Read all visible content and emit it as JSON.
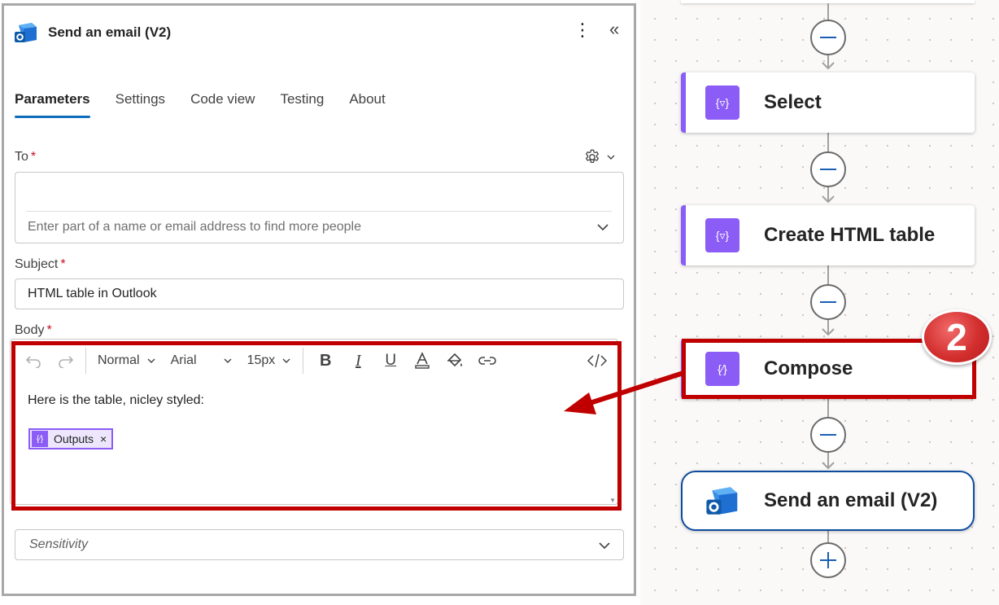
{
  "panel": {
    "title": "Send an email (V2)",
    "tabs": [
      "Parameters",
      "Settings",
      "Code view",
      "Testing",
      "About"
    ],
    "active_tab": "Parameters"
  },
  "fields": {
    "to": {
      "label": "To",
      "required_mark": "*",
      "value": "",
      "placeholder": "Enter part of a name or email address to find more people"
    },
    "subject": {
      "label": "Subject",
      "required_mark": "*",
      "value": "HTML table in Outlook"
    },
    "body": {
      "label": "Body",
      "required_mark": "*",
      "toolbar": {
        "style": "Normal",
        "font": "Arial",
        "size": "15px"
      },
      "text": "Here is the table, nicley styled:",
      "token_label": "Outputs",
      "token_remove": "×"
    },
    "sensitivity": {
      "placeholder": "Sensitivity"
    }
  },
  "flow": {
    "nodes": [
      {
        "label": "Select",
        "icon": "data-operation-icon"
      },
      {
        "label": "Create HTML table",
        "icon": "data-operation-icon"
      },
      {
        "label": "Compose",
        "icon": "data-operation-icon"
      },
      {
        "label": "Send an email (V2)",
        "icon": "outlook-icon"
      }
    ]
  },
  "annotation": {
    "step_number": "2",
    "color": "#c00000"
  },
  "colors": {
    "accent_blue": "#0f6cbd",
    "action_purple": "#8b5cf6",
    "required_red": "#c50f1f"
  }
}
